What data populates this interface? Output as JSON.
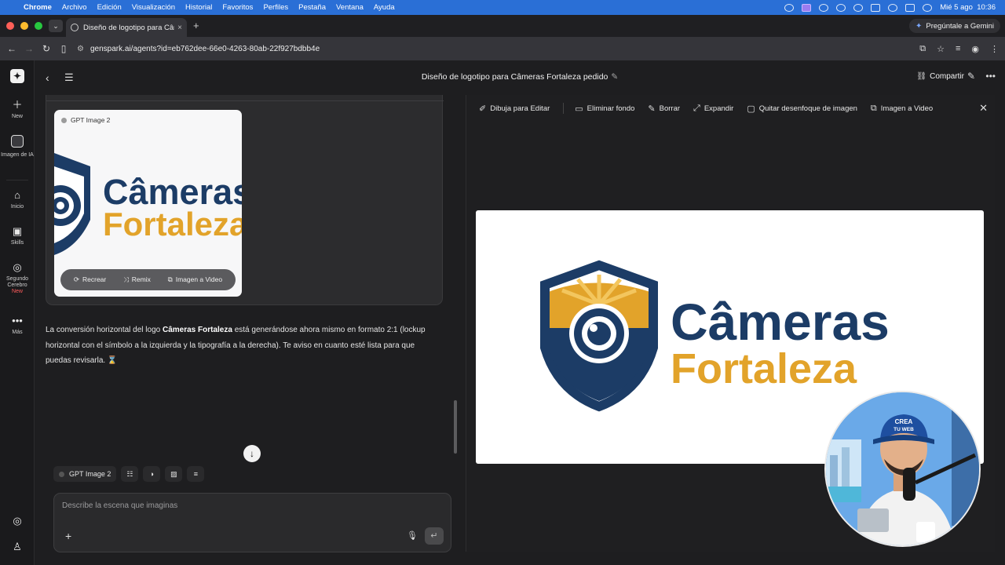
{
  "menubar": {
    "apple_icon": "apple-logo",
    "app": "Chrome",
    "items": [
      "Archivo",
      "Edición",
      "Visualización",
      "Historial",
      "Favoritos",
      "Perfiles",
      "Pestaña",
      "Ventana",
      "Ayuda"
    ],
    "clock": "Mié 5 ago  10:36",
    "accent": "#2a6fd6"
  },
  "tab": {
    "title": "Diseño de logotipo para Câmeras",
    "close": "×",
    "new_tab": "+",
    "gemini_label": "Pregúntale a Gemini"
  },
  "toolbar": {
    "url": "genspark.ai/agents?id=eb762dee-66e0-4263-80ab-22f927bdbb4e"
  },
  "rail": {
    "new": "New",
    "ai_image": "Imagen de IA",
    "home": "Inicio",
    "skills": "Skills",
    "brain_l1": "Segundo",
    "brain_l2": "Cerebro",
    "brain_badge": "New",
    "more": "Más"
  },
  "header": {
    "title": "Diseño de logotipo para Câmeras Fortaleza pedido",
    "share": "Compartir"
  },
  "thumb": {
    "model": "GPT Image 2",
    "logo_line1": "Câmeras",
    "logo_line2": "Fortaleza",
    "actions": {
      "recreate": "Recrear",
      "remix": "Remix",
      "image_to_video": "Imagen a Video"
    }
  },
  "message": {
    "part1": "La conversión horizontal del logo ",
    "bold": "Câmeras Fortaleza",
    "part2": " está generándose ahora mismo en formato 2:1 (lockup horizontal con el símbolo a la izquierda y la tipografía a la derecha). Te aviso en cuanto esté lista para que puedas revisarla. ⌛"
  },
  "composer": {
    "model_chip": "GPT Image 2",
    "placeholder": "Describe la escena que imaginas"
  },
  "panel_tools": {
    "draw_edit": "Dibuja para Editar",
    "remove_bg": "Eliminar fondo",
    "erase": "Borrar",
    "expand": "Expandir",
    "unblur": "Quitar desenfoque de imagen",
    "to_video": "Imagen a Video"
  },
  "preview": {
    "line1": "Câmeras",
    "line2": "Fortaleza",
    "navy": "#1c3c66",
    "gold": "#e2a32a"
  },
  "avatar": {
    "cap_text_1": "CREA",
    "cap_text_2": "TU WEB"
  }
}
